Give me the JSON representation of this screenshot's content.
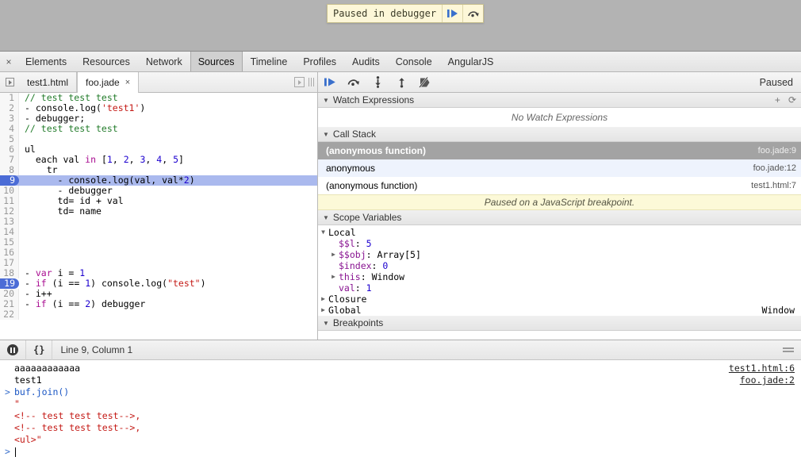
{
  "overlay": {
    "label": "Paused in debugger",
    "resume_icon": "resume-icon",
    "step_over_icon": "step-over-icon"
  },
  "panels": {
    "close_label": "×",
    "tabs": [
      {
        "label": "Elements",
        "active": false
      },
      {
        "label": "Resources",
        "active": false
      },
      {
        "label": "Network",
        "active": false
      },
      {
        "label": "Sources",
        "active": true
      },
      {
        "label": "Timeline",
        "active": false
      },
      {
        "label": "Profiles",
        "active": false
      },
      {
        "label": "Audits",
        "active": false
      },
      {
        "label": "Console",
        "active": false
      },
      {
        "label": "AngularJS",
        "active": false
      }
    ]
  },
  "sources": {
    "file_tabs": [
      {
        "label": "test1.html",
        "active": false,
        "closeable": false
      },
      {
        "label": "foo.jade",
        "active": true,
        "closeable": true,
        "close_label": "×"
      }
    ],
    "debug_buttons": [
      {
        "name": "resume-button",
        "icon": "resume-icon"
      },
      {
        "name": "step-over-button",
        "icon": "step-over-icon"
      },
      {
        "name": "step-into-button",
        "icon": "step-into-icon"
      },
      {
        "name": "step-out-button",
        "icon": "step-out-icon"
      },
      {
        "name": "deactivate-breakpoints-button",
        "icon": "deactivate-breakpoints-icon"
      }
    ],
    "status": "Paused"
  },
  "editor": {
    "lines": [
      {
        "n": "1",
        "html": "<span class='tok-c'>// test test test</span>",
        "state": ""
      },
      {
        "n": "2",
        "html": "- console.log(<span class='tok-str'>'test1'</span>)",
        "state": ""
      },
      {
        "n": "3",
        "html": "- debugger;",
        "state": ""
      },
      {
        "n": "4",
        "html": "<span class='tok-c'>// test test test</span>",
        "state": ""
      },
      {
        "n": "5",
        "html": "",
        "state": ""
      },
      {
        "n": "6",
        "html": "ul",
        "state": ""
      },
      {
        "n": "7",
        "html": "  each val <span class='tok-kw'>in</span> [<span class='tok-num'>1</span>, <span class='tok-num'>2</span>, <span class='tok-num'>3</span>, <span class='tok-num'>4</span>, <span class='tok-num'>5</span>]",
        "state": ""
      },
      {
        "n": "8",
        "html": "    tr",
        "state": ""
      },
      {
        "n": "9",
        "html": "      - console.log(val, val*<span class='tok-num'>2</span>)",
        "state": "cur"
      },
      {
        "n": "10",
        "html": "      - debugger",
        "state": ""
      },
      {
        "n": "11",
        "html": "      td= id + val",
        "state": ""
      },
      {
        "n": "12",
        "html": "      td= name",
        "state": ""
      },
      {
        "n": "13",
        "html": "",
        "state": ""
      },
      {
        "n": "14",
        "html": "",
        "state": ""
      },
      {
        "n": "15",
        "html": "",
        "state": ""
      },
      {
        "n": "16",
        "html": "",
        "state": ""
      },
      {
        "n": "17",
        "html": "",
        "state": ""
      },
      {
        "n": "18",
        "html": "- <span class='tok-kw'>var</span> i = <span class='tok-num'>1</span>",
        "state": ""
      },
      {
        "n": "19",
        "html": "- <span class='tok-kw'>if</span> (i == <span class='tok-num'>1</span>) console.log(<span class='tok-str'>\"test\"</span>)",
        "state": "bp"
      },
      {
        "n": "20",
        "html": "- i++",
        "state": ""
      },
      {
        "n": "21",
        "html": "- <span class='tok-kw'>if</span> (i == <span class='tok-num'>2</span>) debugger",
        "state": ""
      },
      {
        "n": "22",
        "html": "",
        "state": ""
      }
    ]
  },
  "sidebar": {
    "watch": {
      "title": "Watch Expressions",
      "add_label": "+",
      "refresh_label": "⟳",
      "empty": "No Watch Expressions"
    },
    "call_stack": {
      "title": "Call Stack",
      "frames": [
        {
          "name": "(anonymous function)",
          "location": "foo.jade:9",
          "selected": true
        },
        {
          "name": "anonymous",
          "location": "foo.jade:12",
          "selected": false
        },
        {
          "name": "(anonymous function)",
          "location": "test1.html:7",
          "selected": false
        }
      ],
      "pause_reason": "Paused on a JavaScript breakpoint."
    },
    "scope": {
      "title": "Scope Variables",
      "groups": [
        {
          "name": "Local",
          "expanded": true,
          "vars": [
            {
              "name": "$$l",
              "value": "5",
              "vtype": "num",
              "expandable": false
            },
            {
              "name": "$$obj",
              "value": "Array[5]",
              "vtype": "obj",
              "expandable": true
            },
            {
              "name": "$index",
              "value": "0",
              "vtype": "num",
              "expandable": false
            },
            {
              "name": "this",
              "value": "Window",
              "vtype": "obj",
              "expandable": true
            },
            {
              "name": "val",
              "value": "1",
              "vtype": "num",
              "expandable": false
            }
          ]
        },
        {
          "name": "Closure",
          "expanded": false,
          "right": "",
          "vars": []
        },
        {
          "name": "Global",
          "expanded": false,
          "right": "Window",
          "vars": []
        }
      ]
    },
    "breakpoints": {
      "title": "Breakpoints"
    }
  },
  "console": {
    "toolbar": {
      "toggle_icon": "pause-on-exceptions-icon",
      "format_icon": "pretty-print-icon",
      "format_label": "{}",
      "position": "Line 9, Column 1",
      "menu_icon": "hamburger-icon"
    },
    "messages": [
      {
        "arrow": "",
        "text": "aaaaaaaaaaaa",
        "kind": "out",
        "link": "test1.html:6"
      },
      {
        "arrow": "",
        "text": "test1",
        "kind": "out",
        "link": "foo.jade:2"
      },
      {
        "arrow": ">",
        "text": "buf.join()",
        "kind": "input",
        "link": ""
      },
      {
        "arrow": "",
        "text": "\"",
        "kind": "err",
        "link": ""
      },
      {
        "arrow": "",
        "text": "<!-- test test test-->,",
        "kind": "err",
        "link": ""
      },
      {
        "arrow": "",
        "text": "<!-- test test test-->,",
        "kind": "err",
        "link": ""
      },
      {
        "arrow": "",
        "text": "<ul>\"",
        "kind": "err",
        "link": ""
      }
    ],
    "prompt_arrow": ">",
    "prompt_value": ""
  },
  "colors": {
    "accent_blue": "#4b6cd6",
    "current_line": "#aab9ee",
    "pause_yellow": "#fcf9d8",
    "error_red": "#c41a16",
    "string_red": "#c41a16",
    "keyword_magenta": "#a90d91",
    "number_blue": "#1c00cf",
    "comment_green": "#237c2b"
  }
}
